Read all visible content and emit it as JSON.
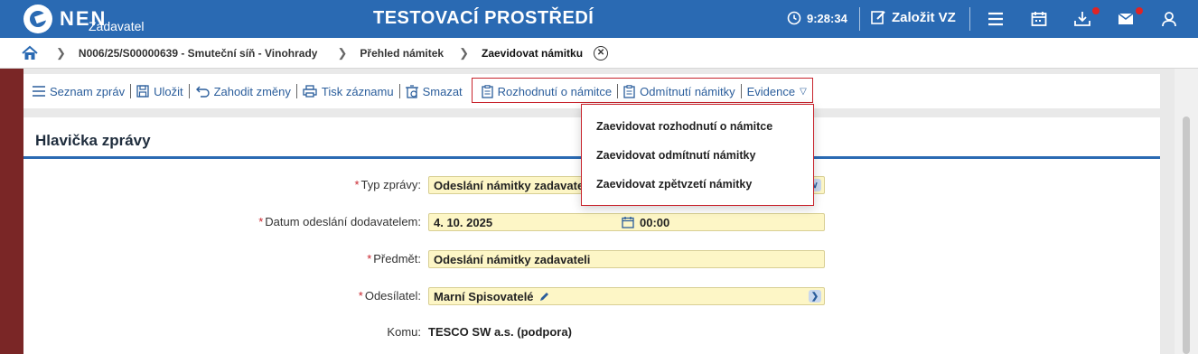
{
  "header": {
    "logo_text": "NEN",
    "logo_sub": "Zadavatel",
    "env_title": "TESTOVACÍ PROSTŘEDÍ",
    "time": "9:28:34",
    "create_label": "Založit VZ",
    "icons": [
      "clock-icon",
      "edit-icon",
      "menu-icon",
      "calendar-icon",
      "download-icon",
      "mail-icon",
      "user-icon"
    ],
    "brand_color": "#2a6ab3"
  },
  "breadcrumb": {
    "items": [
      "N006/25/S00000639 - Smuteční síň - Vinohrady",
      "Přehled námitek"
    ],
    "current": "Zaevidovat námitku"
  },
  "toolbar": {
    "items": [
      "Seznam zpráv",
      "Uložit",
      "Zahodit změny",
      "Tisk záznamu",
      "Smazat",
      "Rozhodnutí o námitce",
      "Odmítnutí námitky",
      "Evidence"
    ]
  },
  "dropdown": {
    "items": [
      "Zaevidovat rozhodnutí o námitce",
      "Zaevidovat odmítnutí námitky",
      "Zaevidovat zpětvzetí námitky"
    ]
  },
  "card": {
    "title": "Hlavička zprávy"
  },
  "form": {
    "type_label": "Typ zprávy:",
    "type_value": "Odeslání námitky zadavateli",
    "date_label": "Datum odeslání dodavatelem:",
    "date_value": "4. 10. 2025",
    "time_value": "00:00",
    "subject_label": "Předmět:",
    "subject_value": "Odeslání námitky zadavateli",
    "sender_label": "Odesílatel:",
    "sender_value": "Marní Spisovatelé",
    "to_label": "Komu:",
    "to_value": "TESCO SW a.s. (podpora)",
    "required_mark": "*"
  }
}
